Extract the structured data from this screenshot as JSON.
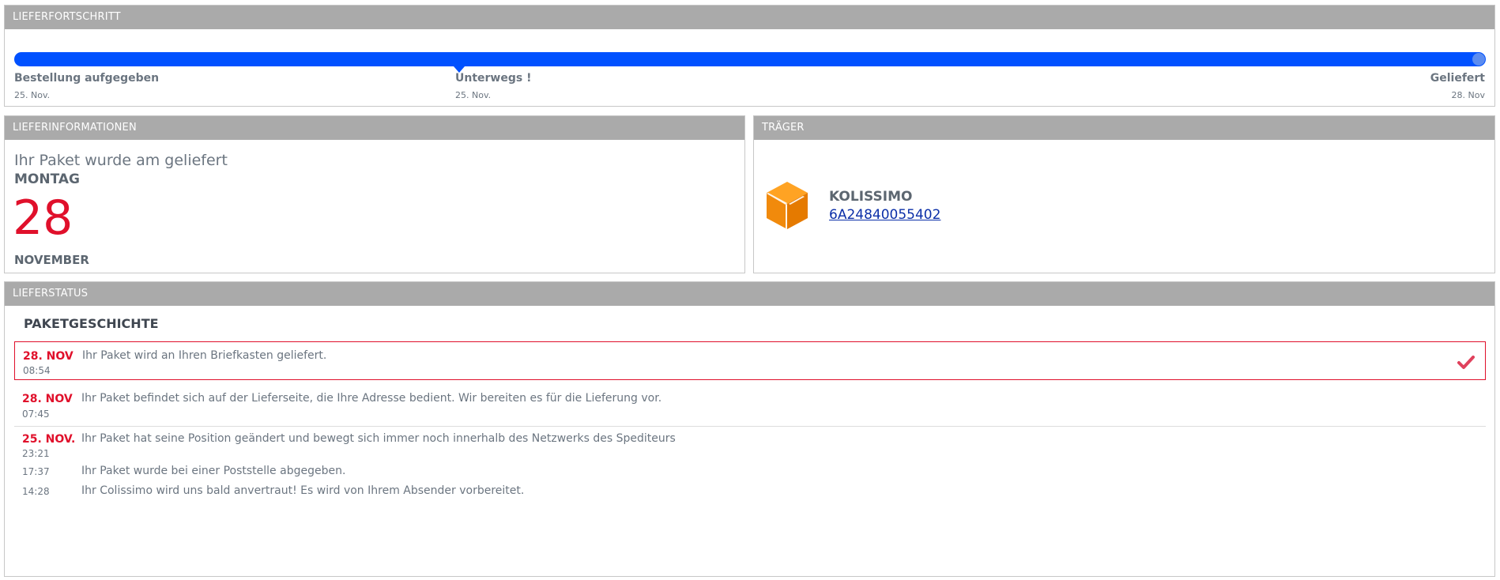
{
  "progress": {
    "header": "LIEFERFORTSCHRITT",
    "percent": 100,
    "steps": [
      {
        "title": "Bestellung aufgegeben",
        "date": "25. Nov."
      },
      {
        "title": "Unterwegs !",
        "date": "25. Nov."
      },
      {
        "title": "Geliefert",
        "date": "28. Nov"
      }
    ],
    "bar_color": "#0051ff"
  },
  "delivery_info": {
    "header": "LIEFERINFORMATIONEN",
    "line": "Ihr Paket wurde am geliefert",
    "weekday": "MONTAG",
    "day": "28",
    "month": "NOVEMBER"
  },
  "carrier": {
    "header": "TRÄGER",
    "icon": "package-box-icon",
    "name": "KOLISSIMO",
    "tracking_number": "6A24840055402"
  },
  "status": {
    "header": "LIEFERSTATUS",
    "history_title": "PAKETGESCHICHTE",
    "events": [
      {
        "date": "28. NOV",
        "time": "08:54",
        "text": "Ihr Paket wird an Ihren Briefkasten geliefert.",
        "active": true
      },
      {
        "date": "28. NOV",
        "time": "07:45",
        "text": "Ihr Paket befindet sich auf der Lieferseite, die Ihre Adresse bedient. Wir bereiten es für die Lieferung vor."
      },
      {
        "date": "25. NOV.",
        "time": "23:21",
        "text": "Ihr Paket hat seine Position geändert und bewegt sich immer noch innerhalb des Netzwerks des Spediteurs"
      },
      {
        "date": "",
        "time": "17:37",
        "text": "Ihr Paket wurde bei einer Poststelle abgegeben."
      },
      {
        "date": "",
        "time": "14:28",
        "text": "Ihr Colissimo wird uns bald anvertraut! Es wird von Ihrem Absender vorbereitet."
      }
    ],
    "accent_color": "#e0102b"
  }
}
